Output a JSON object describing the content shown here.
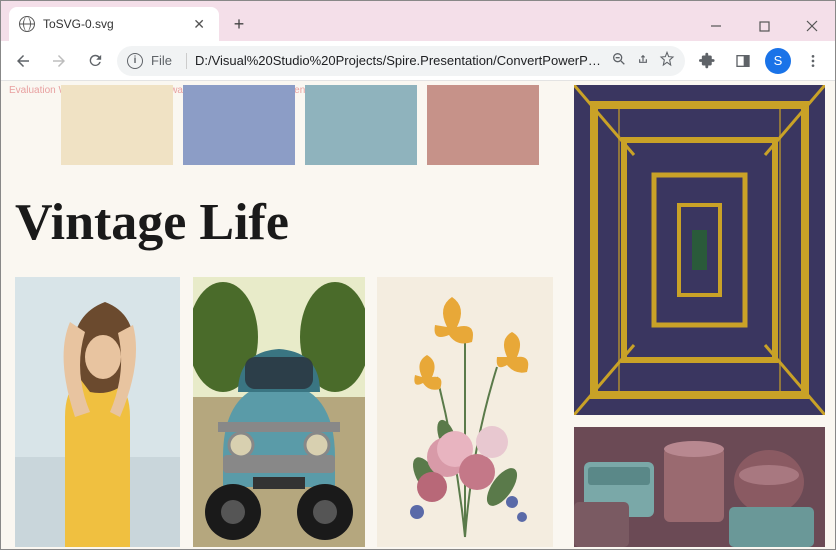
{
  "tab": {
    "title": "ToSVG-0.svg"
  },
  "omnibox": {
    "scheme": "File",
    "url": "D:/Visual%20Studio%20Projects/Spire.Presentation/ConvertPowerPoi..."
  },
  "avatar": {
    "initial": "S"
  },
  "content": {
    "watermark": "Evaluation Warning : The document was created with  Spire.Presentation for .NET",
    "heading": "Vintage Life",
    "swatches": [
      {
        "color": "#f0e2c4"
      },
      {
        "color": "#8c9dc6"
      },
      {
        "color": "#8fb3bd"
      },
      {
        "color": "#c69289"
      }
    ]
  }
}
